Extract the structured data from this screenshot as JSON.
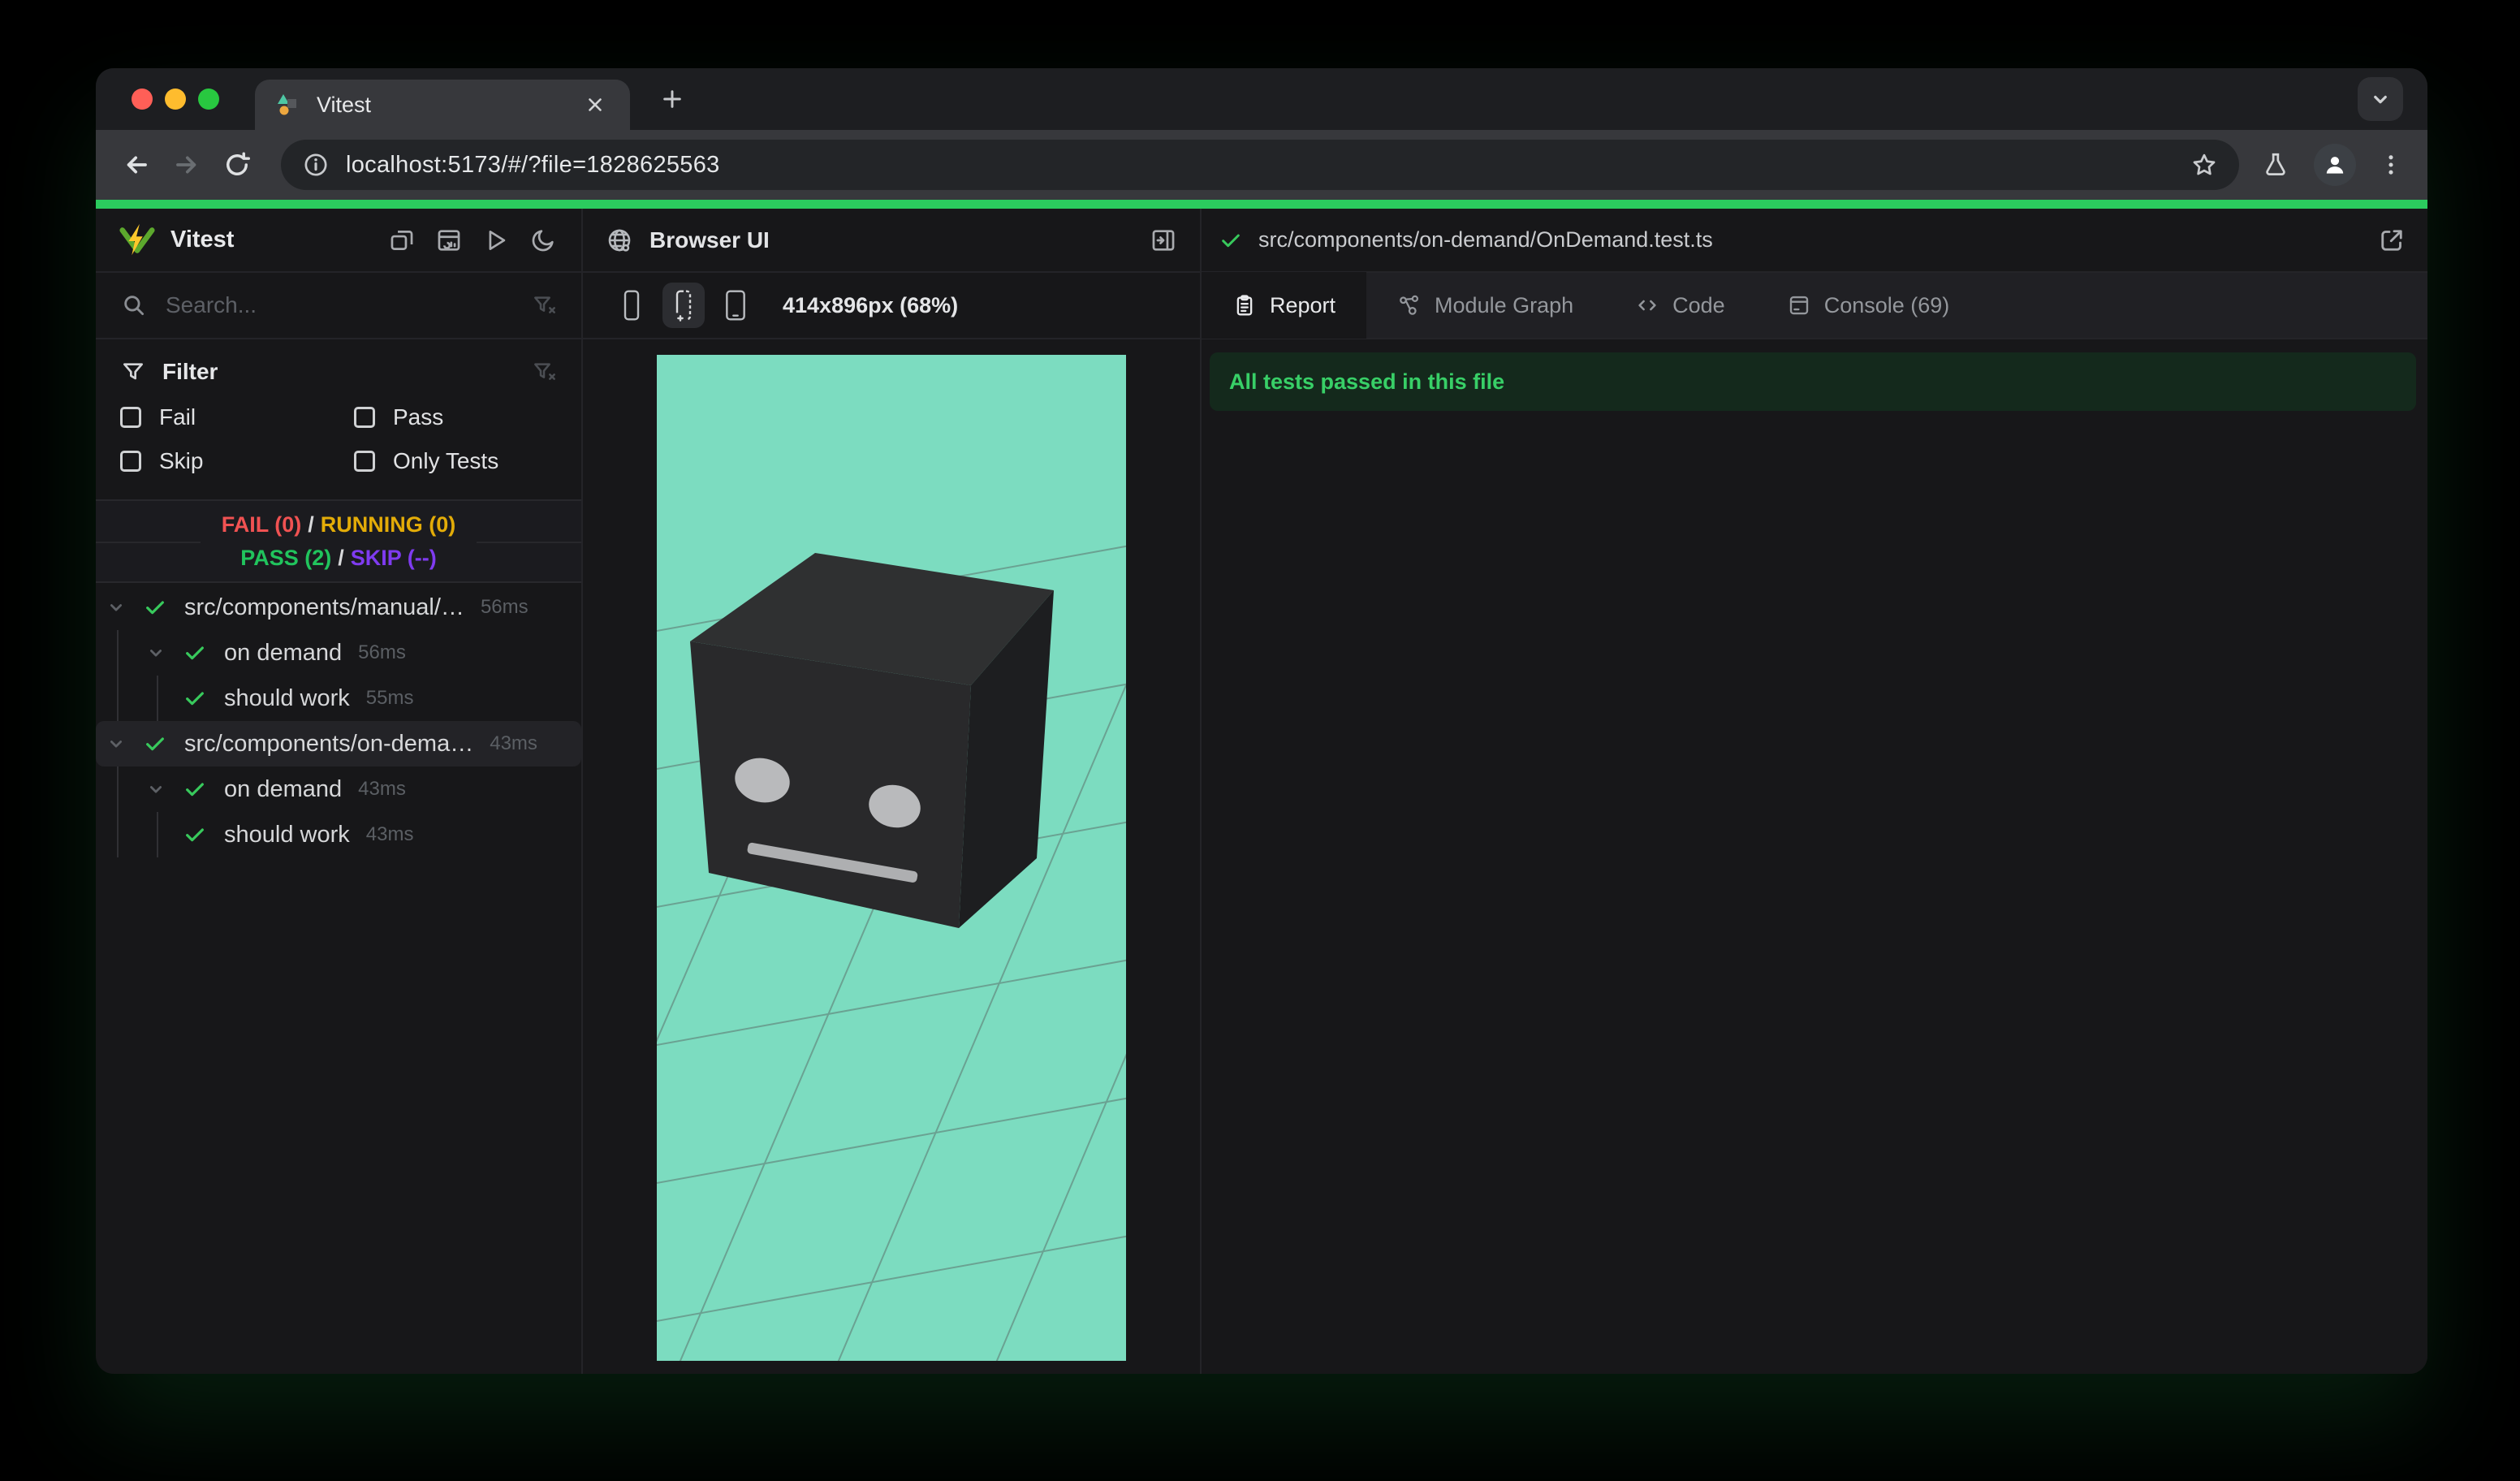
{
  "browser": {
    "tab_title": "Vitest",
    "url": "localhost:5173/#/?file=1828625563"
  },
  "sidebar": {
    "app_name": "Vitest",
    "search_placeholder": "Search...",
    "filter": {
      "title": "Filter",
      "options": [
        {
          "label": "Fail"
        },
        {
          "label": "Pass"
        },
        {
          "label": "Skip"
        },
        {
          "label": "Only Tests"
        }
      ]
    },
    "summary": {
      "fail": "FAIL (0)",
      "sep1": "/",
      "running": "RUNNING (0)",
      "pass": "PASS (2)",
      "sep2": "/",
      "skip": "SKIP (--)"
    },
    "tree": [
      {
        "label": "src/components/manual/…",
        "duration": "56ms"
      },
      {
        "label": "on demand",
        "duration": "56ms"
      },
      {
        "label": "should work",
        "duration": "55ms"
      },
      {
        "label": "src/components/on-dema…",
        "duration": "43ms"
      },
      {
        "label": "on demand",
        "duration": "43ms"
      },
      {
        "label": "should work",
        "duration": "43ms"
      }
    ]
  },
  "middle": {
    "title": "Browser UI",
    "viewport_label": "414x896px (68%)"
  },
  "right": {
    "file_path": "src/components/on-demand/OnDemand.test.ts",
    "tabs": [
      {
        "label": "Report"
      },
      {
        "label": "Module Graph"
      },
      {
        "label": "Code"
      },
      {
        "label": "Console (69)"
      }
    ],
    "banner": "All tests passed in this file"
  },
  "viewport": {
    "bg": "#7cdcc0",
    "grid": "#5a6a66",
    "cube_top": "#2f3031",
    "cube_front": "#29292b",
    "cube_right": "#1d1e20",
    "eye": "#b9babc",
    "mouth": "#aeafb1"
  },
  "colors": {
    "accent_green": "#2bcb5e",
    "fail": "#f05252",
    "running": "#e3ac08",
    "pass": "#21c45d",
    "skip": "#7f3bf0",
    "check": "#38c95c",
    "banner_bg": "#14291c",
    "banner_text": "#38cf67"
  }
}
